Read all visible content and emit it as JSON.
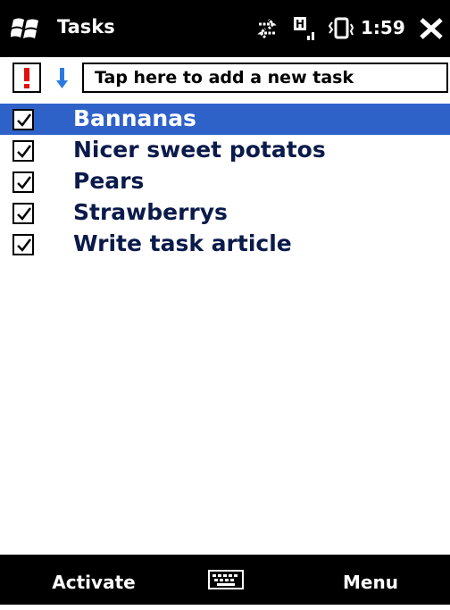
{
  "title_bar": {
    "app_title": "Tasks",
    "clock": "1:59",
    "icons": [
      "windows-logo-icon",
      "connectivity-icon",
      "signal-icon",
      "vibrate-icon",
      "close-icon"
    ]
  },
  "toolbar": {
    "add_task_placeholder": "Tap here to add a new task",
    "priority_high_icon": "exclamation-icon",
    "priority_low_icon": "down-arrow-icon"
  },
  "tasks": [
    {
      "label": "Bannanas",
      "checked": true,
      "selected": true
    },
    {
      "label": "Nicer sweet potatos",
      "checked": true,
      "selected": false
    },
    {
      "label": "Pears",
      "checked": true,
      "selected": false
    },
    {
      "label": "Strawberrys",
      "checked": true,
      "selected": false
    },
    {
      "label": "Write task article",
      "checked": true,
      "selected": false
    }
  ],
  "menu_bar": {
    "left_softkey": "Activate",
    "right_softkey": "Menu",
    "center_icon": "keyboard-icon"
  },
  "colors": {
    "selection": "#2f62c9",
    "priority_high": "#e01010",
    "priority_low": "#2a7be0",
    "bars": "#000000"
  }
}
